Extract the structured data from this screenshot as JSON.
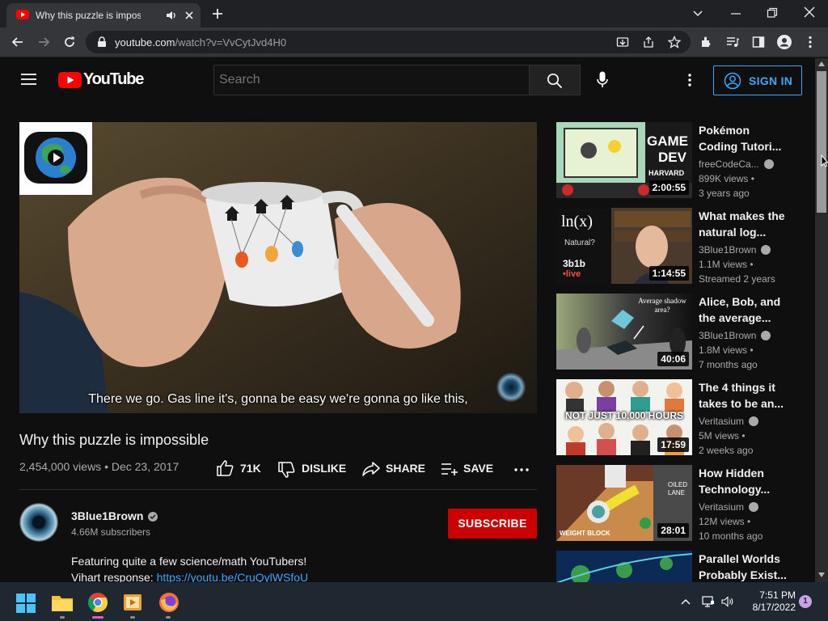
{
  "browser": {
    "tab_title": "Why this puzzle is impossible",
    "url_host": "youtube.com",
    "url_path": "/watch?v=VvCytJvd4H0"
  },
  "youtube": {
    "logo_text": "YouTube",
    "search_placeholder": "Search",
    "sign_in_label": "SIGN IN",
    "video": {
      "caption": "There we go. Gas line it's, gonna be easy we're gonna go like this,",
      "title": "Why this puzzle is impossible",
      "meta": "2,454,000 views • Dec 23, 2017",
      "like_count": "71K",
      "dislike_label": "DISLIKE",
      "share_label": "SHARE",
      "save_label": "SAVE"
    },
    "channel": {
      "name": "3Blue1Brown",
      "subscribers": "4.66M subscribers",
      "subscribe_label": "SUBSCRIBE"
    },
    "description": {
      "line1": "Featuring quite a few science/math YouTubers!",
      "line2_prefix": "Vihart response: ",
      "line2_link": "https://youtu.be/CruQylWSfoU"
    },
    "recommended": [
      {
        "title": "Pokémon Coding Tutori...",
        "channel": "freeCodeCa...",
        "views": "899K views •",
        "age": "3 years ago",
        "duration": "2:00:55"
      },
      {
        "title": "What makes the natural log...",
        "channel": "3Blue1Brown",
        "views": "1.1M views •",
        "age": "Streamed 2 years",
        "duration": "1:14:55"
      },
      {
        "title": "Alice, Bob, and the average...",
        "channel": "3Blue1Brown",
        "views": "1.8M views •",
        "age": "7 months ago",
        "duration": "40:06"
      },
      {
        "title": "The 4 things it takes to be an...",
        "channel": "Veritasium",
        "views": "5M views •",
        "age": "2 weeks ago",
        "duration": "17:59"
      },
      {
        "title": "How Hidden Technology...",
        "channel": "Veritasium",
        "views": "12M views •",
        "age": "10 months ago",
        "duration": "28:01"
      },
      {
        "title": "Parallel Worlds Probably Exist..."
      }
    ],
    "thumb_text": {
      "game": "GAME",
      "dev": "DEV",
      "harvard": "HARVARD",
      "ln": "ln(x)",
      "natural": "Natural?",
      "brand": "3b1b",
      "live": "•live",
      "shadow": "Average shadow area?",
      "hours": "NOT JUST 10,000 HOURS",
      "oiled": "OILED LANE",
      "weight": "WEIGHT BLOCK"
    }
  },
  "taskbar": {
    "time": "7:51 PM",
    "date": "8/17/2022",
    "notification_count": "1"
  },
  "colors": {
    "accent_blue": "#3ea6ff",
    "subscribe_red": "#cc0000",
    "youtube_red": "#ff0000"
  }
}
